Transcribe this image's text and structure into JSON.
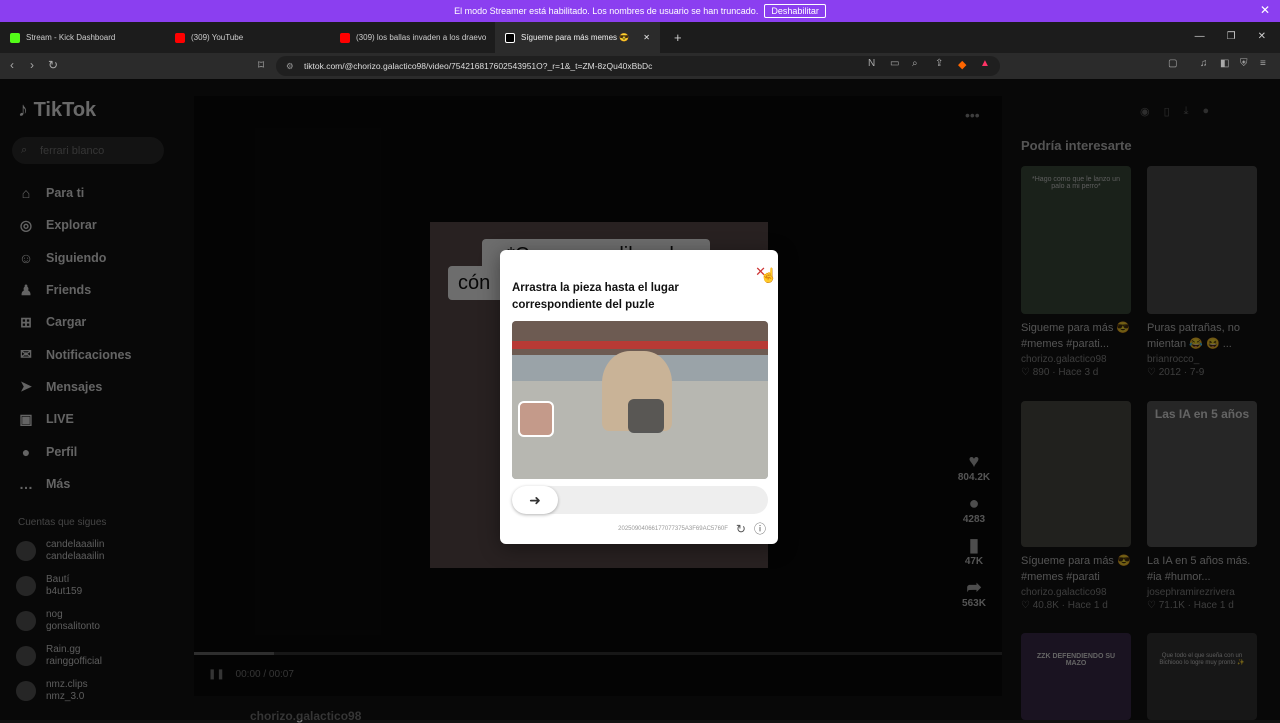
{
  "streamer_bar": {
    "message": "El modo Streamer está habilitado. Los nombres de usuario se han truncado.",
    "button": "Deshabilitar",
    "close": "✕"
  },
  "tabs": [
    {
      "label": "Stream - Kick Dashboard",
      "color": "#53fc18"
    },
    {
      "label": "(309) YouTube",
      "color": "#ff0000"
    },
    {
      "label": "(309) los ballas invaden a los draevo",
      "color": "#ff0000"
    },
    {
      "label": "Sígueme para más memes 😎",
      "color": "#ffffff"
    }
  ],
  "window_controls": {
    "min": "—",
    "max": "❐",
    "close": "✕"
  },
  "address": {
    "url": "tiktok.com/@chorizo.galactico98/video/754216817602543951O?_r=1&_t=ZM-8zQu40xBbDc"
  },
  "sidebar": {
    "logo": "TikTok",
    "search_placeholder": "ferrari blanco",
    "items": [
      {
        "label": "Para ti",
        "icon": "⌂"
      },
      {
        "label": "Explorar",
        "icon": "◎"
      },
      {
        "label": "Siguiendo",
        "icon": "☺"
      },
      {
        "label": "Friends",
        "icon": "♟"
      },
      {
        "label": "Cargar",
        "icon": "⊞"
      },
      {
        "label": "Notificaciones",
        "icon": "✉"
      },
      {
        "label": "Mensajes",
        "icon": "➤"
      },
      {
        "label": "LIVE",
        "icon": "▣"
      },
      {
        "label": "Perfil",
        "icon": "●"
      },
      {
        "label": "Más",
        "icon": "…"
      }
    ],
    "follows_title": "Cuentas que sigues",
    "follows": [
      {
        "name": "candelaaailin",
        "user": "candelaaailin"
      },
      {
        "name": "Bautí",
        "user": "b4ut159"
      },
      {
        "name": "nog",
        "user": "gonsalitonto"
      },
      {
        "name": "Rain.gg",
        "user": "rainggofficial"
      },
      {
        "name": "nmz.clips",
        "user": "nmz_3.0"
      }
    ]
  },
  "video": {
    "caption_line1": "*Compro un libro de",
    "caption_line2": "cón",
    "time": "00:00 / 00:07",
    "author": "chorizo.galactico98",
    "likes": "804.2K",
    "comments": "4283",
    "saves": "47K",
    "shares": "563K"
  },
  "captcha": {
    "title": "Arrastra la pieza hasta el lugar correspondiente del puzle",
    "code": "20250904066177077375A3F69AC5760F"
  },
  "right": {
    "title": "Podría interesarte",
    "cards": [
      {
        "title": "Sigueme para más 😎 #memes #parati...",
        "user": "chorizo.galactico98",
        "meta": "♡ 890 · Hace 3 d",
        "caption": "*Hago como que le lanzo un palo a mi perro*"
      },
      {
        "title": "Puras patrañas, no mientan 😂 😆 ...",
        "user": "brianrocco_",
        "meta": "♡ 2012 · 7-9",
        "caption": ""
      },
      {
        "title": "Sígueme para más 😎 #memes #parati",
        "user": "chorizo.galactico98",
        "meta": "♡ 40.8K · Hace 1 d",
        "caption": ""
      },
      {
        "title": "La IA en 5 años más. #ia #humor...",
        "user": "josephramirezrivera",
        "meta": "♡ 71.1K · Hace 1 d",
        "caption": "Las IA en 5 años"
      },
      {
        "title": "",
        "user": "",
        "meta": "",
        "caption": "ZZK DEFENDIENDO SU MAZO"
      },
      {
        "title": "",
        "user": "",
        "meta": "",
        "caption": "Que todo el que sueña con un Bichiooo lo logre muy pronto ✨"
      }
    ]
  }
}
